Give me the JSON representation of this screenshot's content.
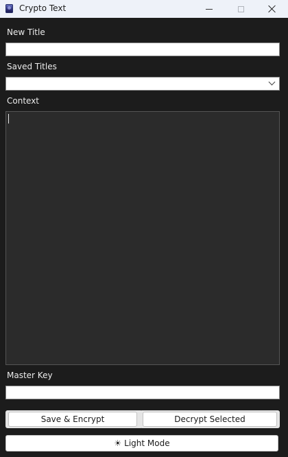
{
  "window": {
    "title": "Crypto Text"
  },
  "form": {
    "new_title_label": "New Title",
    "new_title_value": "",
    "saved_titles_label": "Saved Titles",
    "saved_titles_selected": "",
    "context_label": "Context",
    "context_value": "",
    "master_key_label": "Master Key",
    "master_key_value": ""
  },
  "buttons": {
    "save_encrypt": "Save & Encrypt",
    "decrypt_selected": "Decrypt Selected",
    "light_mode_icon": "☀",
    "light_mode": "Light Mode"
  }
}
